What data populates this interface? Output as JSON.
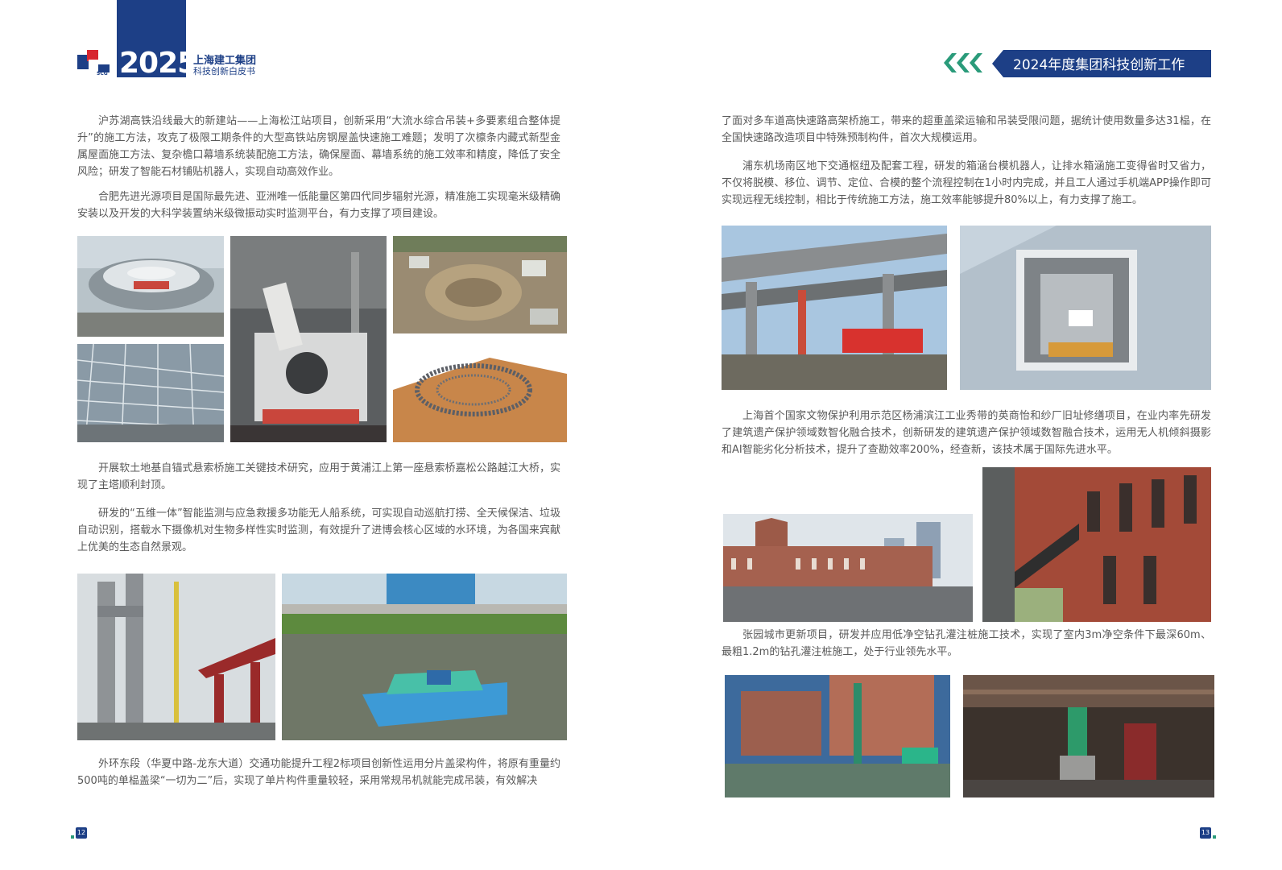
{
  "header": {
    "year": "2025",
    "brand_line1": "上海建工集团",
    "brand_line2": "科技创新白皮书",
    "logo_text": "SCG",
    "section_title": "2024年度集团科技创新工作"
  },
  "left_page": {
    "paragraphs": [
      "沪苏湖高铁沿线最大的新建站——上海松江站项目，创新采用“大流水综合吊装+多要素组合整体提升”的施工方法，攻克了极限工期条件的大型高铁站房钢屋盖快速施工难题；发明了次檩条内藏式新型金属屋面施工方法、复杂檐口幕墙系统装配施工方法，确保屋面、幕墙系统的施工效率和精度，降低了安全风险；研发了智能石材铺贴机器人，实现自动高效作业。",
      "合肥先进光源项目是国际最先进、亚洲唯一低能量区第四代同步辐射光源，精准施工实现毫米级精确安装以及开发的大科学装置纳米级微振动实时监测平台，有力支撑了项目建设。",
      "开展软土地基自锚式悬索桥施工关键技术研究，应用于黄浦江上第一座悬索桥嘉松公路越江大桥，实现了主塔顺利封顶。",
      "研发的“五维一体”智能监测与应急救援多功能无人船系统，可实现自动巡航打捞、全天候保洁、垃圾自动识别，搭载水下摄像机对生物多样性实时监测，有效提升了进博会核心区域的水环境，为各国来宾献上优美的生态自然景观。",
      "外环东段（华夏中路-龙东大道）交通功能提升工程2标项目创新性运用分片盖梁构件，将原有重量约500吨的单榀盖梁“一切为二”后，实现了单片构件重量较轻，采用常规吊机就能完成吊装，有效解决"
    ],
    "page_number": "12"
  },
  "right_page": {
    "paragraphs": [
      "了面对多车道高快速路高架桥施工，带来的超重盖梁运输和吊装受限问题，据统计使用数量多达31榀，在全国快速路改造项目中特殊预制构件，首次大规模运用。",
      "浦东机场南区地下交通枢纽及配套工程，研发的箱涵台模机器人，让排水箱涵施工变得省时又省力，不仅将脱模、移位、调节、定位、合模的整个流程控制在1小时内完成，并且工人通过手机端APP操作即可实现远程无线控制，相比于传统施工方法，施工效率能够提升80%以上，有力支撑了施工。",
      "上海首个国家文物保护利用示范区杨浦滨江工业秀带的英商怡和纱厂旧址修缮项目，在业内率先研发了建筑遗产保护领域数智化融合技术，创新研发的建筑遗产保护领域数智融合技术，运用无人机倾斜摄影和AI智能劣化分析技术，提升了查勘效率200%，经查新，该技术属于国际先进水平。",
      "张园城市更新项目，研发并应用低净空钻孔灌注桩施工技术，实现了室内3m净空条件下最深60m、最粗1.2m的钻孔灌注桩施工，处于行业领先水平。"
    ],
    "page_number": "13"
  },
  "colors": {
    "brand_blue": "#1d3f86",
    "accent_green": "#2a9b7a",
    "logo_red": "#d7262f",
    "body_text": "#595959"
  },
  "icons": [
    "scg-logo-icon",
    "chevron-right-icon"
  ]
}
